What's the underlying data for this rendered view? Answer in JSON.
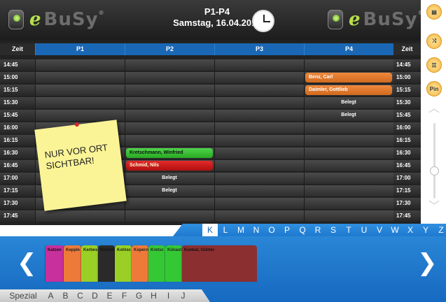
{
  "header": {
    "logo_text": "e BuSy",
    "registered_mark": "®",
    "title_line1": "P1-P4",
    "title_line2": "Samstag, 16.04.2011"
  },
  "columns": {
    "time_label": "Zeit",
    "resources": [
      "P1",
      "P2",
      "P3",
      "P4"
    ]
  },
  "times": [
    "14:45",
    "15:00",
    "15:15",
    "15:30",
    "15:45",
    "16:00",
    "16:15",
    "16:30",
    "16:45",
    "17:00",
    "17:15",
    "17:30",
    "17:45"
  ],
  "appointments": [
    {
      "label": "Benz, Carl",
      "color": "orange"
    },
    {
      "label": "Daimler, Gottlieb",
      "color": "orange"
    },
    {
      "label": "Kretschmann, Winfried",
      "color": "green"
    },
    {
      "label": "Schmid, Nils",
      "color": "red"
    }
  ],
  "belegt_label": "Belegt",
  "sticky_note": "NUR VOR ORT SICHTBAR!",
  "sidebar": {
    "buttons": [
      {
        "icon": "presentation-icon"
      },
      {
        "icon": "shuffle-icon"
      },
      {
        "icon": "list-icon"
      },
      {
        "label": "Pin"
      }
    ]
  },
  "alphabet_top": [
    "K",
    "L",
    "M",
    "N",
    "O",
    "P",
    "Q",
    "R",
    "S",
    "T",
    "U",
    "V",
    "W",
    "X",
    "Y",
    "Z"
  ],
  "alphabet_bottom": [
    "Spezial",
    "A",
    "B",
    "C",
    "D",
    "E",
    "F",
    "G",
    "H",
    "I",
    "J"
  ],
  "cards": [
    {
      "label": "Katzen",
      "color": "#c8309c"
    },
    {
      "label": "Kepple",
      "color": "#ee7a3a"
    },
    {
      "label": "Kerbes",
      "color": "#9ad026"
    },
    {
      "label": "Klöckn",
      "color": "#2a2a2a"
    },
    {
      "label": "Kohlsc",
      "color": "#9ad026"
    },
    {
      "label": "Kopern",
      "color": "#ee7a3a"
    },
    {
      "label": "Kretsc",
      "color": "#35c835"
    },
    {
      "label": "Künast",
      "color": "#35c835"
    },
    {
      "label": "Kunkat, Günter",
      "color": "#8b2f30"
    }
  ],
  "colors": {
    "accent_blue": "#1a67b5",
    "orange": "#e07a2e",
    "green": "#35c835",
    "red": "#c81818"
  }
}
